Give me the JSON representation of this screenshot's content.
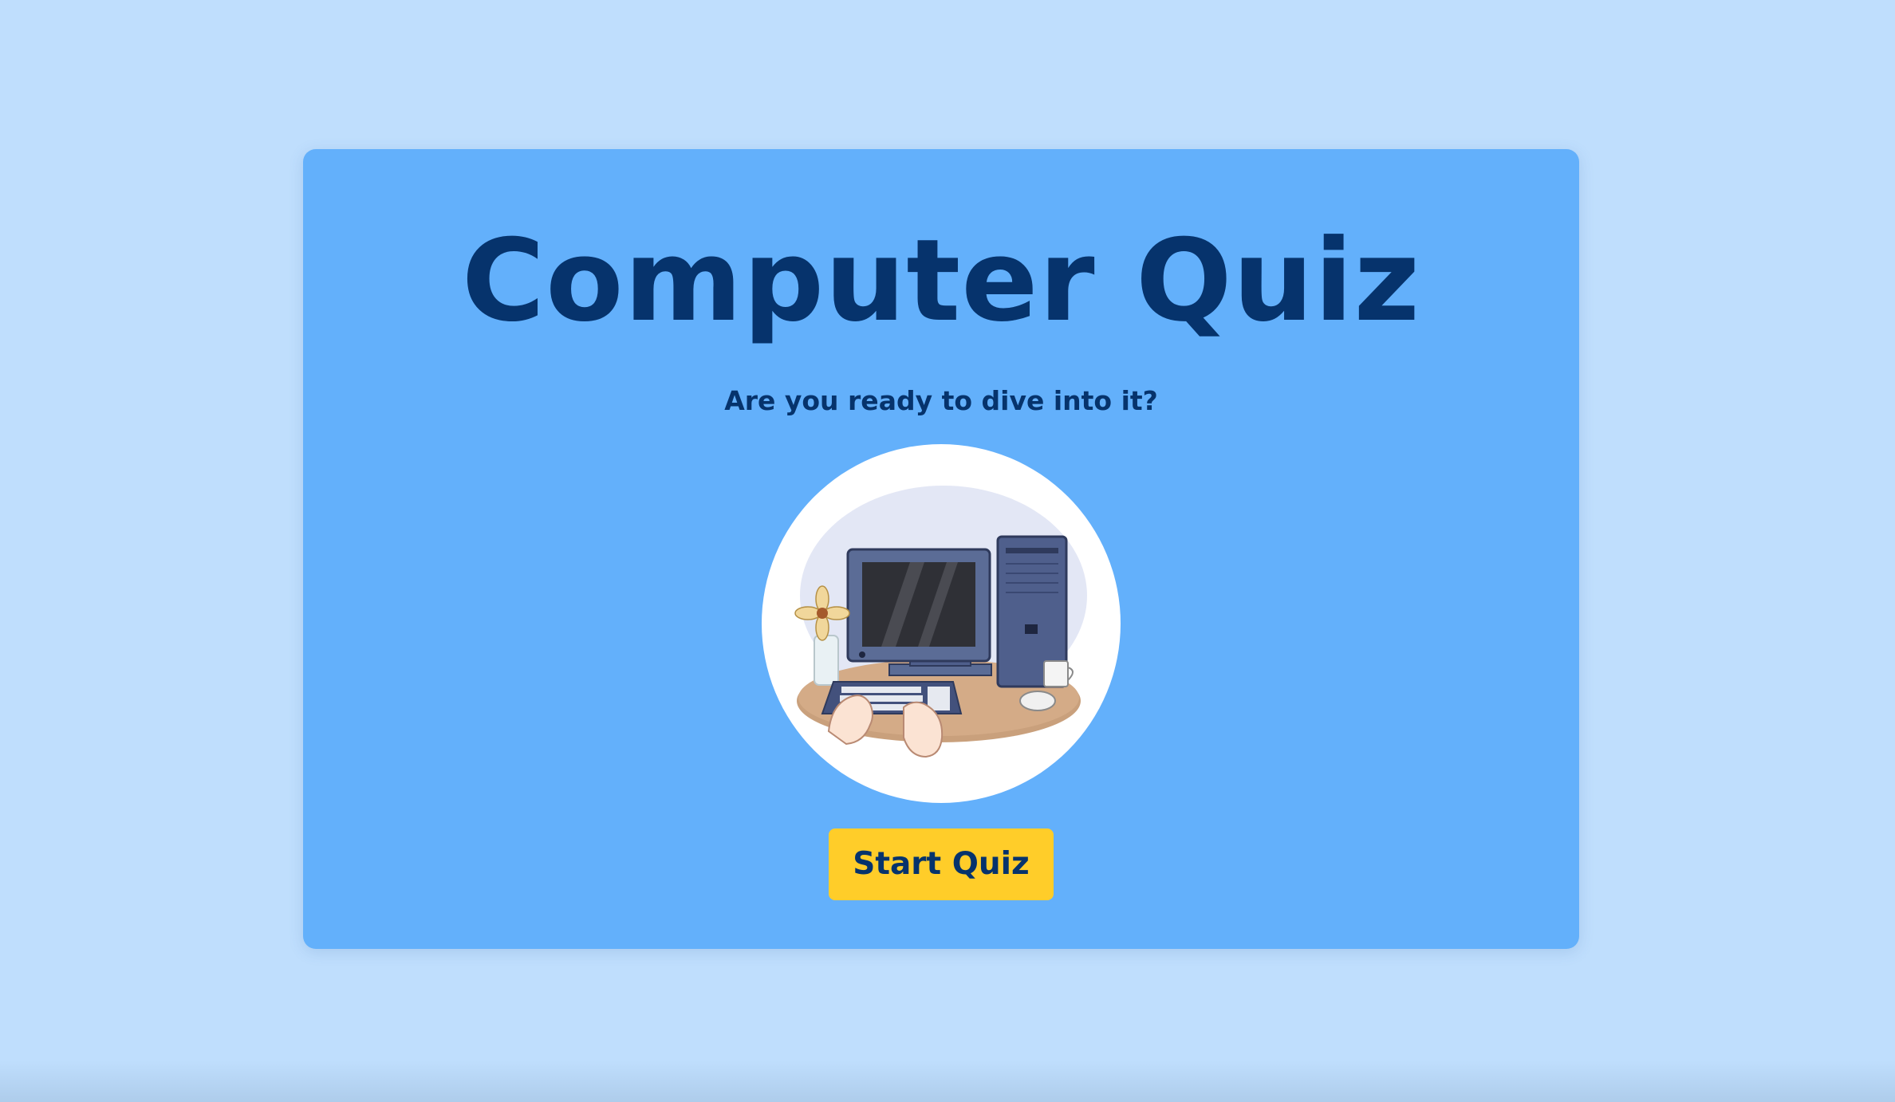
{
  "quiz": {
    "title": "Computer Quiz",
    "subtitle": "Are you ready to dive into it?",
    "start_button_label": "Start Quiz"
  },
  "colors": {
    "page_background": "#bfdefd",
    "card_background": "#63b0fb",
    "text": "#06336c",
    "button_background": "#ffcd29"
  },
  "icons": {
    "illustration": "computer-desk-illustration"
  }
}
